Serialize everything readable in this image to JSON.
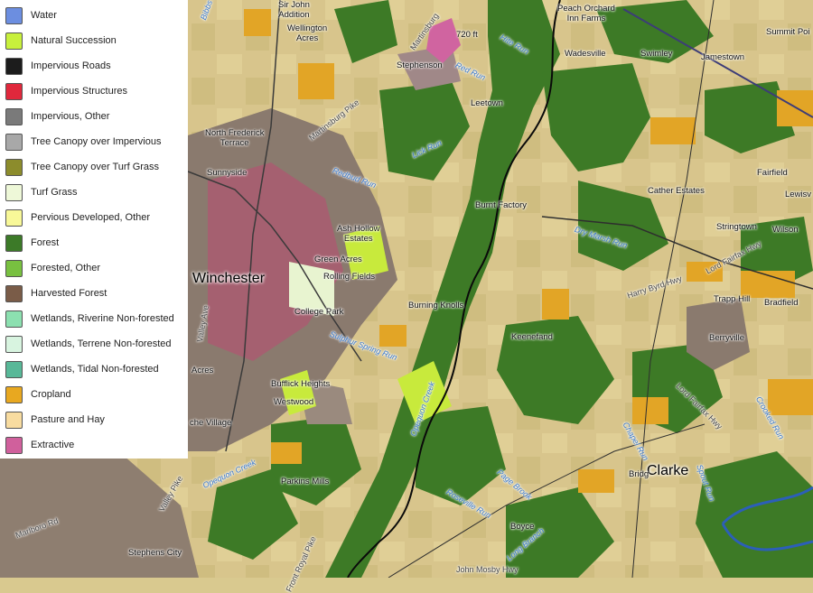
{
  "legend": {
    "items": [
      {
        "label": "Water",
        "color": "#6c8ee0"
      },
      {
        "label": "Natural Succession",
        "color": "#c8f03c"
      },
      {
        "label": "Impervious Roads",
        "color": "#1c1c1c"
      },
      {
        "label": "Impervious Structures",
        "color": "#e0283c"
      },
      {
        "label": "Impervious, Other",
        "color": "#7a7a7a"
      },
      {
        "label": "Tree Canopy over Impervious",
        "color": "#a8a8a8"
      },
      {
        "label": "Tree Canopy over Turf Grass",
        "color": "#8c8c2c"
      },
      {
        "label": "Turf Grass",
        "color": "#eef8d8"
      },
      {
        "label": "Pervious Developed, Other",
        "color": "#f8f898"
      },
      {
        "label": "Forest",
        "color": "#3c7a28"
      },
      {
        "label": "Forested, Other",
        "color": "#78c040"
      },
      {
        "label": "Harvested Forest",
        "color": "#7a5c48"
      },
      {
        "label": "Wetlands, Riverine Non-forested",
        "color": "#8ce0b0"
      },
      {
        "label": "Wetlands, Terrene Non-forested",
        "color": "#d8f4e0"
      },
      {
        "label": "Wetlands, Tidal Non-forested",
        "color": "#58b898"
      },
      {
        "label": "Cropland",
        "color": "#e8a820"
      },
      {
        "label": "Pasture and Hay",
        "color": "#f8dca0"
      },
      {
        "label": "Extractive",
        "color": "#d0609c"
      }
    ]
  },
  "places": {
    "winchester": "Winchester",
    "clarke": "Clarke",
    "sir_john_addition": "Sir John\nAddition",
    "wellington_acres": "Wellington\nAcres",
    "stephenson": "Stephenson",
    "elevation": "720 ft",
    "peach_orchard": "Peach Orchard\nInn Farms",
    "wadesville": "Wadesville",
    "swimley": "Swimley",
    "jamestown": "Jamestown",
    "summit_point": "Summit Poi",
    "leetown": "Leetown",
    "north_frederick": "North Frederick\nTerrace",
    "sunnyside": "Sunnyside",
    "fairfield": "Fairfield",
    "lewisville": "Lewisv",
    "cather_estates": "Cather Estates",
    "burnt_factory": "Burnt Factory",
    "stringtown": "Stringtown",
    "wilson": "Wilson",
    "ash_hollow": "Ash Hollow\nEstates",
    "green_acres": "Green Acres",
    "rolling_fields": "Rolling Fields",
    "trapp_hill": "Trapp Hill",
    "bradfield": "Bradfield",
    "college_park": "College Park",
    "burning_knolls": "Burning Knolls",
    "berryville": "Berryville",
    "keenefand": "Keenefand",
    "acres": "Acres",
    "bufflick_heights": "Bufflick Heights",
    "westwood": "Westwood",
    "che_village": "che Village",
    "parkins_mills": "Parkins Mills",
    "bridg": "Bridg",
    "boyce": "Boyce",
    "stephens_city": "Stephens City"
  },
  "streams": {
    "bibbs_run": "Bibbs Run",
    "opequon": "Opequon Creek",
    "hite_run": "Hite Run",
    "red_run": "Red Run",
    "lick_run": "Lick Run",
    "redbud_run": "Redbud Run",
    "dry_marsh_run": "Dry Marsh Run",
    "sulphur_spring_run": "Sulphur Spring Run",
    "opequon_creek_lower": "Opequon Creek",
    "roseville_run": "Roseville Run",
    "page_brook": "Page Brook",
    "long_branch": "Long Branch",
    "chapel_run": "Chapel Run",
    "spout_run": "Spout Run",
    "crooked_run": "Crooked Run",
    "lower_creek": "Opequon Creek"
  },
  "roads": {
    "martinsburg_pike": "Martinsburg Pike",
    "martinsburg_pike_n": "Martinsburg",
    "harry_byrd_hwy": "Harry Byrd Hwy",
    "lord_fairfax_hwy": "Lord Fairfax Hwy",
    "valley_ave": "Valley Ave",
    "valley_pike": "Valley Pike",
    "fairfax_pike": "Fairfax Pike",
    "millwood_pike": "Millwood Pike",
    "middle_rd": "Middle Rd",
    "front_royal_pike": "Front Royal Pike",
    "marlboro_rd": "Marlboro Rd",
    "john_mosby_hwy": "John Mosby Hwy",
    "lord_fairfax_s": "Lord Fairfax Hwy",
    "rt": "Rd"
  }
}
